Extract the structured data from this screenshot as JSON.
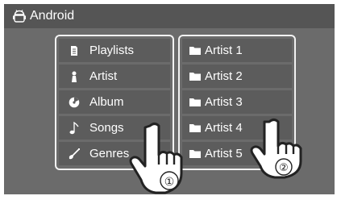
{
  "title": "Android",
  "list_left": [
    {
      "label": "Playlists",
      "icon": "playlist-icon"
    },
    {
      "label": "Artist",
      "icon": "artist-icon"
    },
    {
      "label": "Album",
      "icon": "album-icon"
    },
    {
      "label": "Songs",
      "icon": "note-icon"
    },
    {
      "label": "Genres",
      "icon": "guitar-icon"
    }
  ],
  "list_right": [
    {
      "label": "Artist 1",
      "icon": "folder-icon"
    },
    {
      "label": "Artist 2",
      "icon": "folder-icon"
    },
    {
      "label": "Artist 3",
      "icon": "folder-icon"
    },
    {
      "label": "Artist 4",
      "icon": "folder-icon"
    },
    {
      "label": "Artist 5",
      "icon": "folder-icon"
    }
  ],
  "callouts": [
    "①",
    "②"
  ]
}
